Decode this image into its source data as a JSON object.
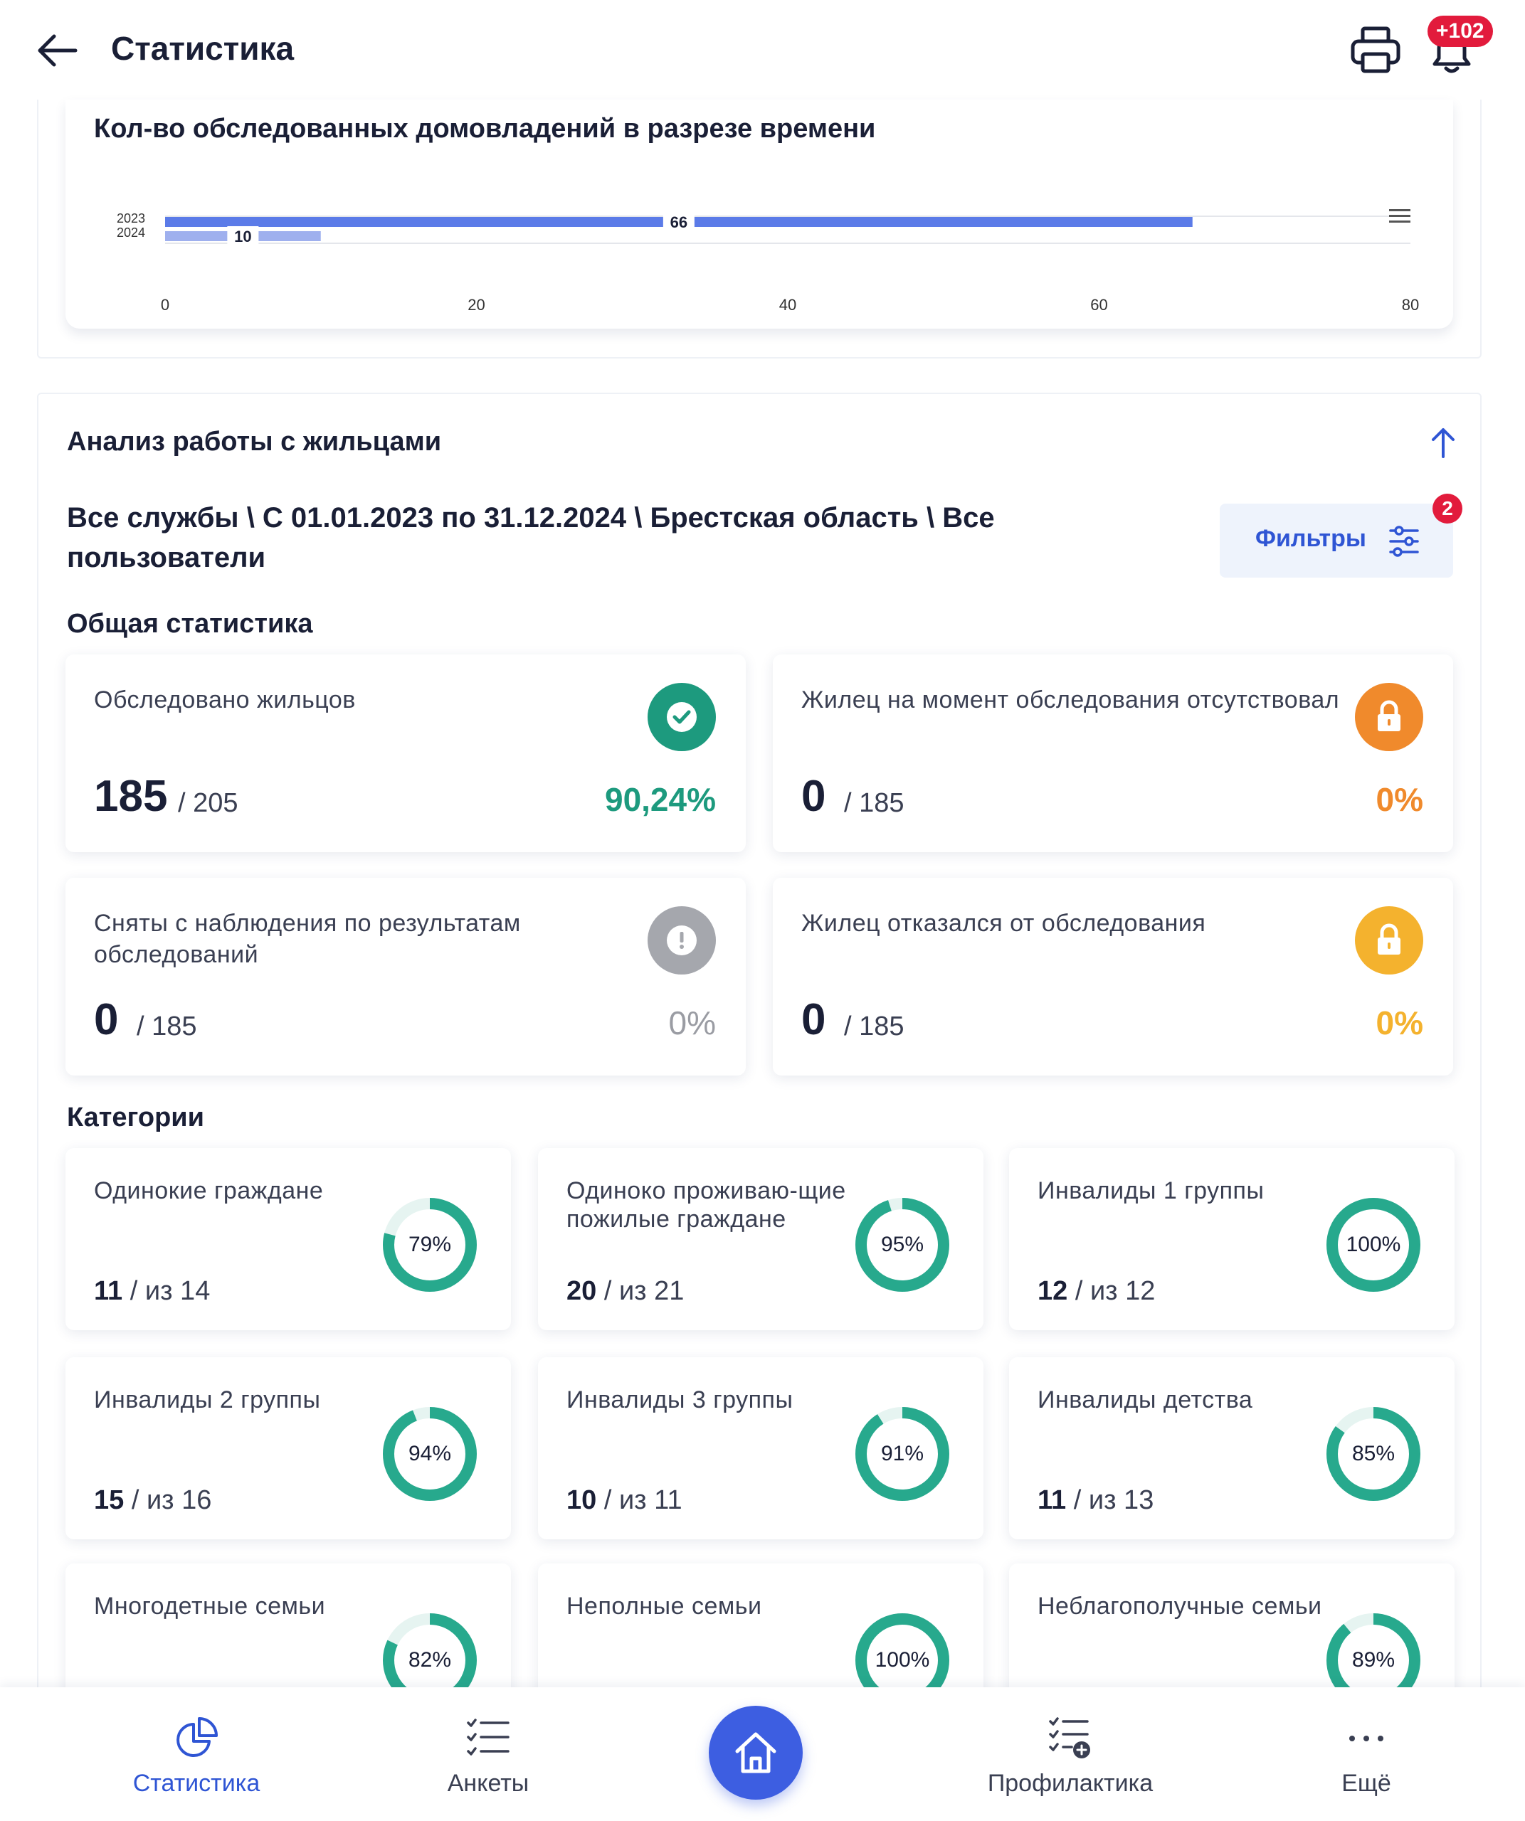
{
  "header": {
    "title": "Статистика",
    "notifications_badge": "+102"
  },
  "chart_card": {
    "title": "Кол-во обследованных домовладений в разрезе времени"
  },
  "chart_data": {
    "type": "bar",
    "orientation": "horizontal",
    "categories": [
      "2023",
      "2024"
    ],
    "series": [
      {
        "values": [
          66,
          10
        ]
      }
    ],
    "data_labels": [
      "66",
      "10"
    ],
    "xlim": [
      0,
      80
    ],
    "x_ticks": [
      "0",
      "20",
      "40",
      "60",
      "80"
    ],
    "grid": true,
    "colors": [
      "#5b7be8",
      "#9fb0ee"
    ]
  },
  "analysis": {
    "title": "Анализ работы с жильцами",
    "filters_summary": "Все службы \\ С 01.01.2023 по 31.12.2024 \\ Брестская область \\ Все пользователи",
    "filters_button": "Фильтры",
    "filters_count": "2"
  },
  "general": {
    "title": "Общая статистика",
    "cards": [
      {
        "label": "Обследовано жильцов",
        "value": "185",
        "total": "/ 205",
        "percent": "90,24%",
        "color": "#1d9a7e",
        "icon": "check-icon"
      },
      {
        "label": "Жилец на момент обследования отсутствовал",
        "value": "0",
        "total": "/ 185",
        "percent": "0%",
        "color": "#f08a2c",
        "icon": "lock-icon"
      },
      {
        "label": "Сняты с наблюдения по результатам обследований",
        "value": "0",
        "total": "/ 185",
        "percent": "0%",
        "color": "#9a9ca3",
        "icon": "alert-icon"
      },
      {
        "label": "Жилец отказался от обследования",
        "value": "0",
        "total": "/ 185",
        "percent": "0%",
        "color": "#f4b22e",
        "icon": "lock-icon"
      }
    ]
  },
  "categories": {
    "title": "Категории",
    "items": [
      {
        "label": "Одинокие граждане",
        "count": "11",
        "of": "/ из 14",
        "percent": 79,
        "percent_label": "79%"
      },
      {
        "label": "Одиноко проживаю-щие пожилые граждане",
        "count": "20",
        "of": "/ из 21",
        "percent": 95,
        "percent_label": "95%"
      },
      {
        "label": "Инвалиды 1 группы",
        "count": "12",
        "of": "/ из 12",
        "percent": 100,
        "percent_label": "100%"
      },
      {
        "label": "Инвалиды 2 группы",
        "count": "15",
        "of": "/ из 16",
        "percent": 94,
        "percent_label": "94%"
      },
      {
        "label": "Инвалиды 3 группы",
        "count": "10",
        "of": "/ из 11",
        "percent": 91,
        "percent_label": "91%"
      },
      {
        "label": "Инвалиды детства",
        "count": "11",
        "of": "/ из 13",
        "percent": 85,
        "percent_label": "85%"
      },
      {
        "label": "Многодетные семьи",
        "count": "",
        "of": "",
        "percent": 82,
        "percent_label": "82%"
      },
      {
        "label": "Неполные семьи",
        "count": "",
        "of": "",
        "percent": 100,
        "percent_label": "100%"
      },
      {
        "label": "Неблагополучные семьи",
        "count": "",
        "of": "",
        "percent": 89,
        "percent_label": "89%"
      }
    ],
    "ring_color": "#27a98d",
    "ring_track": "#e6f4f1"
  },
  "bottom_nav": {
    "items": [
      {
        "label": "Статистика",
        "icon": "pie-chart-icon"
      },
      {
        "label": "Анкеты",
        "icon": "checklist-icon"
      },
      {
        "label": "",
        "icon": "home-icon"
      },
      {
        "label": "Профилактика",
        "icon": "checklist-add-icon"
      },
      {
        "label": "Ещё",
        "icon": "more-icon"
      }
    ]
  }
}
